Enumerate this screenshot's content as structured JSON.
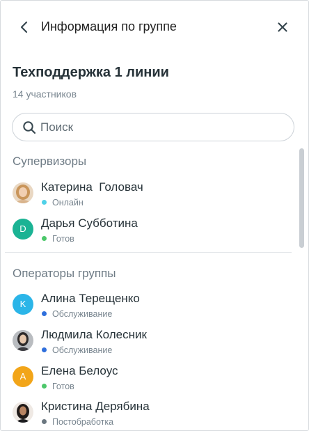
{
  "header": {
    "title": "Информация по группе",
    "back_icon": "chevron-left-icon",
    "close_icon": "close-icon"
  },
  "group": {
    "name": "Техподдержка 1 линии",
    "members_count": "14 участников"
  },
  "search": {
    "placeholder": "Поиск",
    "value": ""
  },
  "sections": {
    "supervisors": {
      "title": "Супервизоры",
      "members": [
        {
          "name": "Катерина  Головач",
          "status": "Онлайн",
          "status_color": "#4fd1e8",
          "avatar": "photo"
        },
        {
          "name": "Дарья Субботина",
          "status": "Готов",
          "status_color": "#4cc76a",
          "avatar": "letter",
          "avatar_letter": "D",
          "avatar_color": "#1bb394"
        }
      ]
    },
    "operators": {
      "title": "Операторы группы",
      "members": [
        {
          "name": "Алина Терещенко",
          "status": "Обслуживание",
          "status_color": "#2f6fdc",
          "avatar": "letter",
          "avatar_letter": "K",
          "avatar_color": "#2bb5e8"
        },
        {
          "name": "Людмила Колесник",
          "status": "Обслуживание",
          "status_color": "#2f6fdc",
          "avatar": "photo"
        },
        {
          "name": "Елена Белоус",
          "status": "Готов",
          "status_color": "#4cc76a",
          "avatar": "letter",
          "avatar_letter": "A",
          "avatar_color": "#f2a519"
        },
        {
          "name": "Кристина Дерябина",
          "status": "Постобработка",
          "status_color": "#6b7780",
          "avatar": "photo"
        }
      ]
    }
  }
}
